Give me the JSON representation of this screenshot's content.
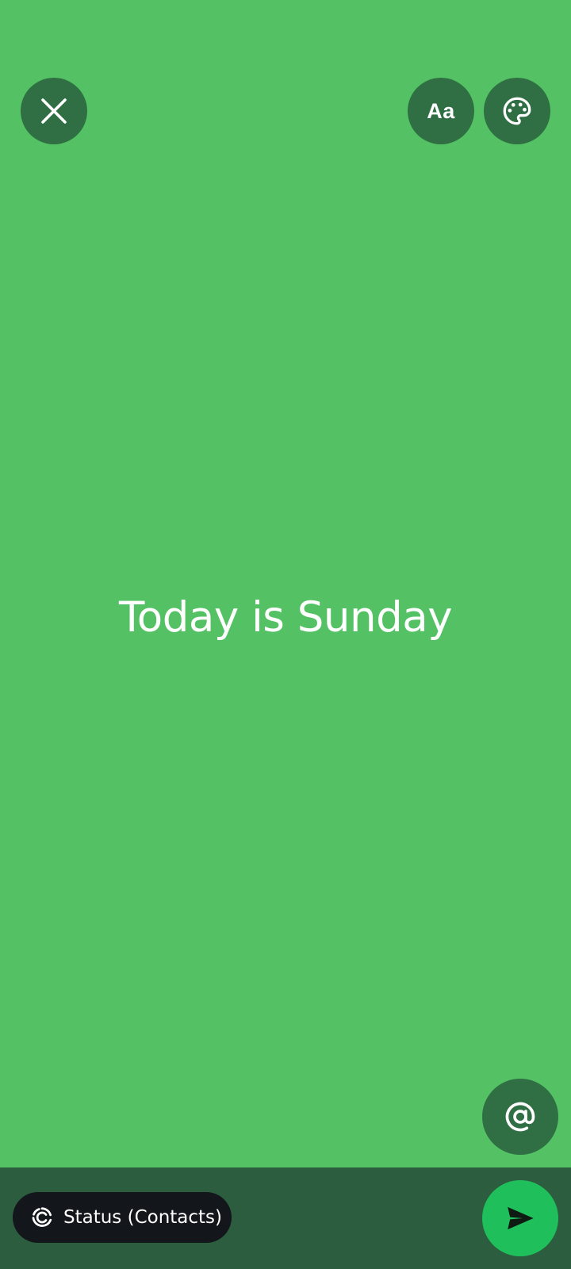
{
  "colors": {
    "background": "#54C264",
    "button_overlay": "#2F6F43",
    "bottom_bar": "#2C5D3E",
    "chip": "#13161A",
    "send_accent": "#1FBF5C",
    "icon_light": "#FFFFFF",
    "send_icon": "#0E1A12"
  },
  "toolbar": {
    "close_icon": "close-icon",
    "font_button_label": "Aa",
    "palette_icon": "palette-icon"
  },
  "status": {
    "text": "Today is Sunday"
  },
  "mention": {
    "icon": "at-sign-icon"
  },
  "bottom_bar": {
    "audience_label": "Status (Contacts)",
    "audience_icon": "status-ring-icon",
    "send_icon": "send-icon"
  }
}
